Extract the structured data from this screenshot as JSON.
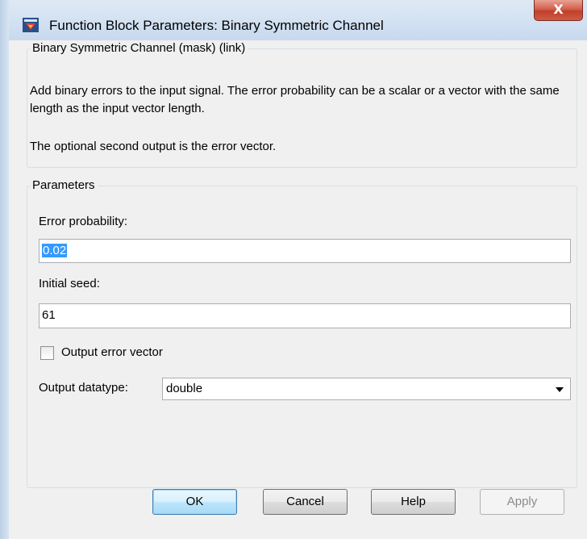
{
  "window": {
    "title": "Function Block Parameters: Binary Symmetric Channel",
    "close_label": "X"
  },
  "description": {
    "legend": "Binary Symmetric Channel (mask) (link)",
    "text1": "Add binary errors to the input signal. The error probability can be a scalar or a vector with the same length as the input vector length.",
    "text2": "The optional second output is the error vector."
  },
  "parameters": {
    "legend": "Parameters",
    "error_probability_label": "Error probability:",
    "error_probability_value": "0.02",
    "initial_seed_label": "Initial seed:",
    "initial_seed_value": "61",
    "output_error_vector_label": "Output error vector",
    "output_error_vector_checked": false,
    "output_datatype_label": "Output datatype:",
    "output_datatype_value": "double"
  },
  "buttons": {
    "ok": "OK",
    "cancel": "Cancel",
    "help": "Help",
    "apply": "Apply"
  }
}
